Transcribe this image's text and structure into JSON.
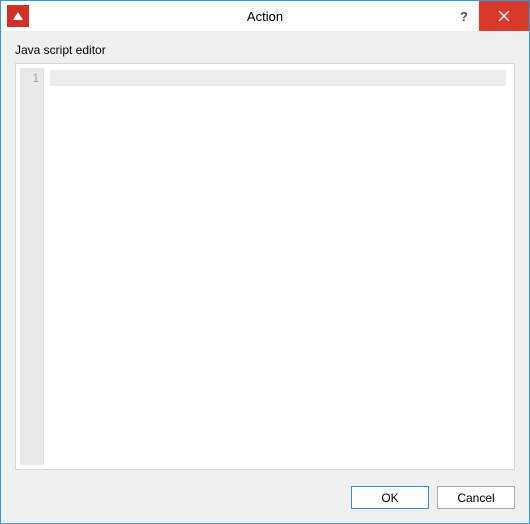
{
  "window": {
    "title": "Action"
  },
  "editor": {
    "label": "Java script editor",
    "line_numbers": [
      "1"
    ],
    "content": ""
  },
  "buttons": {
    "ok": "OK",
    "cancel": "Cancel"
  }
}
